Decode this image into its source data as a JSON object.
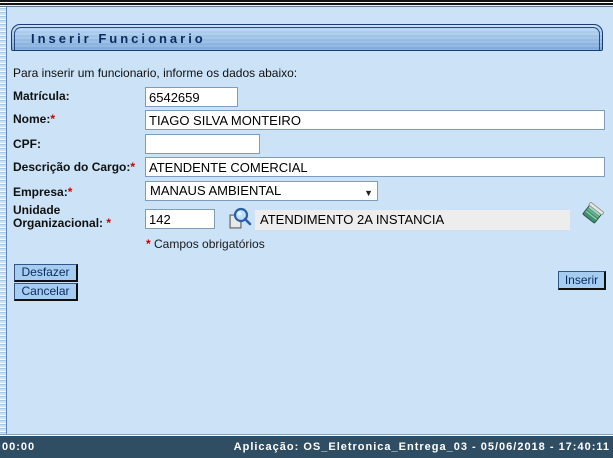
{
  "form": {
    "title": "Inserir Funcionario",
    "intro": "Para inserir um funcionario, informe os dados abaixo:",
    "required_marker": "*",
    "fields": {
      "matricula": {
        "label": "Matrícula:",
        "value": "6542659"
      },
      "nome": {
        "label": "Nome:",
        "value": "TIAGO SILVA MONTEIRO"
      },
      "cpf": {
        "label": "CPF:",
        "value": ""
      },
      "cargo": {
        "label": "Descrição do Cargo:",
        "value": "ATENDENTE COMERCIAL"
      },
      "empresa": {
        "label": "Empresa:",
        "selected_option": "MANAUS AMBIENTAL"
      },
      "unidade": {
        "label": "Unidade Organizacional:",
        "code": "142",
        "description": "ATENDIMENTO 2A INSTANCIA"
      }
    },
    "required_note_star": "*",
    "required_note_text": " Campos obrigatórios",
    "buttons": {
      "desfazer": "Desfazer",
      "cancelar": "Cancelar",
      "inserir": "Inserir"
    }
  },
  "icons": {
    "lookup": "magnifier-icon",
    "clear": "eraser-icon",
    "dropdown": "chevron-down-icon"
  },
  "glyphs": {
    "dropdown_arrow": "▼"
  },
  "statusbar": {
    "timer": "00:00",
    "application_info": "Aplicação: OS_Eletronica_Entrega_03 - 05/06/2018 - 17:40:11"
  },
  "colors": {
    "page_background": "#CBE2F7",
    "header_text": "#0A2B5E",
    "button_background": "#A6CDF0",
    "statusbar_background": "#2F4D63",
    "required": "#CC0000",
    "readonly_background": "#EDEDED"
  }
}
